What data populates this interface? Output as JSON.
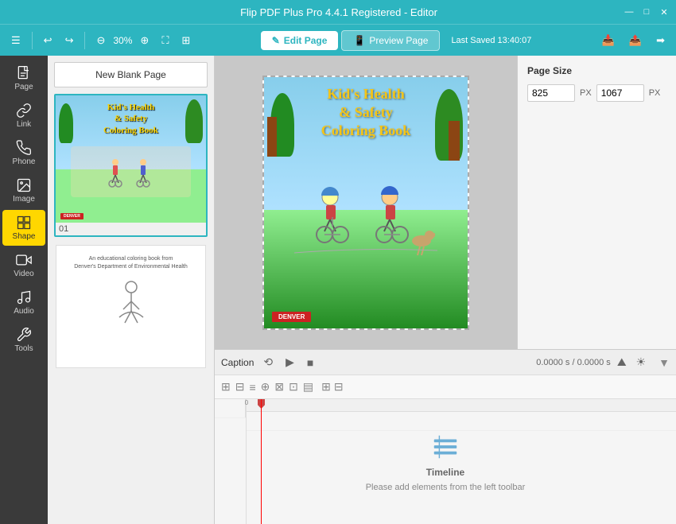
{
  "titlebar": {
    "title": "Flip PDF Plus Pro 4.4.1 Registered - Editor",
    "minimize": "—",
    "maximize": "□",
    "close": "✕"
  },
  "toolbar": {
    "undo_label": "↩",
    "redo_label": "↪",
    "zoom_out_label": "⊖",
    "zoom_percent": "30%",
    "zoom_in_label": "⊕",
    "fit_label": "⛶",
    "grid_label": "⊞",
    "edit_page_label": "Edit Page",
    "preview_page_label": "Preview Page",
    "last_saved": "Last Saved 13:40:07",
    "import_icon": "📥",
    "export_left_icon": "📤",
    "export_right_icon": "➡"
  },
  "sidebar": {
    "items": [
      {
        "id": "page",
        "label": "Page",
        "icon": "page"
      },
      {
        "id": "link",
        "label": "Link",
        "icon": "link"
      },
      {
        "id": "phone",
        "label": "Phone",
        "icon": "phone"
      },
      {
        "id": "image",
        "label": "Image",
        "icon": "image"
      },
      {
        "id": "shape",
        "label": "Shape",
        "icon": "shape"
      },
      {
        "id": "video",
        "label": "Video",
        "icon": "video"
      },
      {
        "id": "audio",
        "label": "Audio",
        "icon": "audio"
      },
      {
        "id": "tools",
        "label": "Tools",
        "icon": "tools"
      }
    ],
    "active": "shape"
  },
  "pages_panel": {
    "new_blank_label": "New Blank Page",
    "page1_num": "01",
    "page1_title_line1": "Kid's Health",
    "page1_title_line2": "& Safety",
    "page1_title_line3": "Coloring Book",
    "page1_denver": "DENVER",
    "page2_text_line1": "An educational coloring book from",
    "page2_text_line2": "Denver's Department of Environmental Health"
  },
  "canvas": {
    "cover_title_line1": "Kid's Health",
    "cover_title_line2": "& Safety",
    "cover_title_line3": "Coloring Book",
    "denver_label": "DENVER"
  },
  "right_panel": {
    "page_size_label": "Page Size",
    "width_value": "825",
    "height_value": "1067",
    "px_label1": "PX",
    "px_label2": "PX"
  },
  "timeline": {
    "caption_label": "Caption",
    "rewind_icon": "⟲",
    "play_icon": "▶",
    "stop_icon": "■",
    "time_display": "0.0000 s / 0.0000 s",
    "mountain_icon": "⛰",
    "sun_icon": "☀",
    "collapse_icon": "▼",
    "empty_title": "Timeline",
    "empty_desc": "Please add elements from the left toolbar",
    "tl_icon": "⊞"
  }
}
